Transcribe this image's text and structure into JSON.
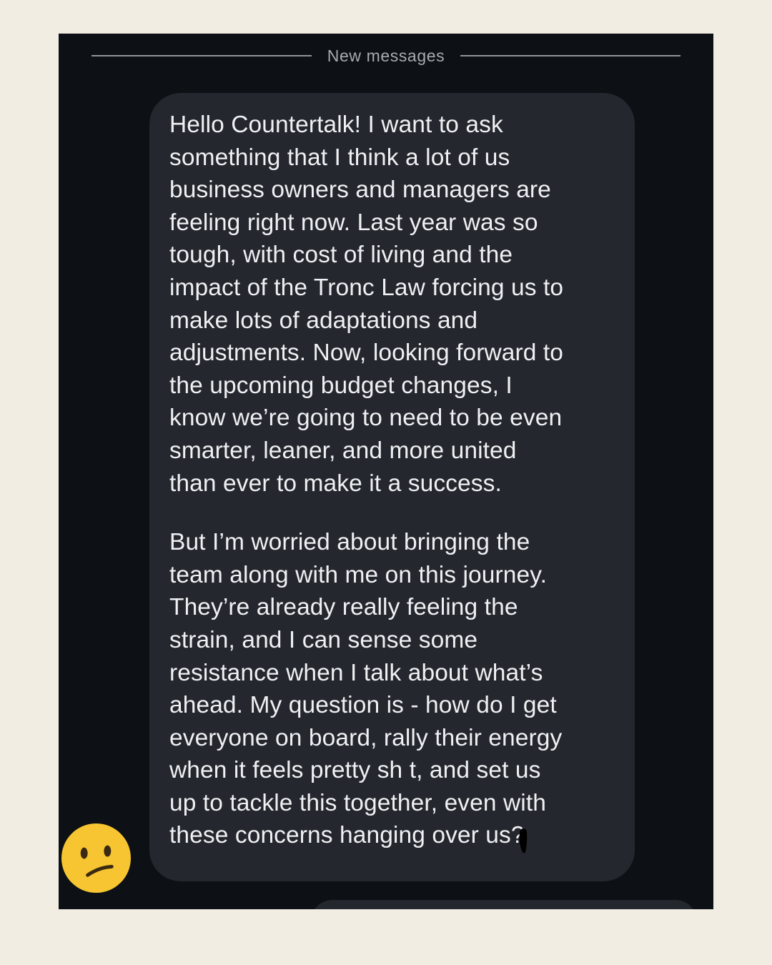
{
  "divider": {
    "label": "New messages"
  },
  "message": {
    "paragraphs": [
      "Hello Countertalk! I want to ask\nsomething that I think a lot of us\nbusiness owners and managers are\nfeeling right now. Last year was so\ntough, with cost of living and the\nimpact of the Tronc Law forcing us to\nmake lots of adaptations and\nadjustments. Now, looking forward to\nthe upcoming budget changes, I\nknow we’re going to need to be even\nsmarter, leaner, and more united\nthan ever to make it a success.",
      "But I’m worried about bringing the\nteam along with me on this journey.\nThey’re already really feeling the\nstrain, and I can sense some\nresistance when I talk about what’s\nahead. My question is - how do I get\neveryone on board, rally their energy\nwhen it feels pretty sh t, and set us\nup to tackle this together, even with\nthese concerns hanging over us?"
    ]
  },
  "avatar": {
    "icon": "confused-face-emoji",
    "color": "#f7c531"
  },
  "theme": {
    "page_background": "#f1ede3",
    "screen_background": "#0d1014",
    "bubble_background": "#24272d",
    "text_color": "#eef0f3"
  }
}
